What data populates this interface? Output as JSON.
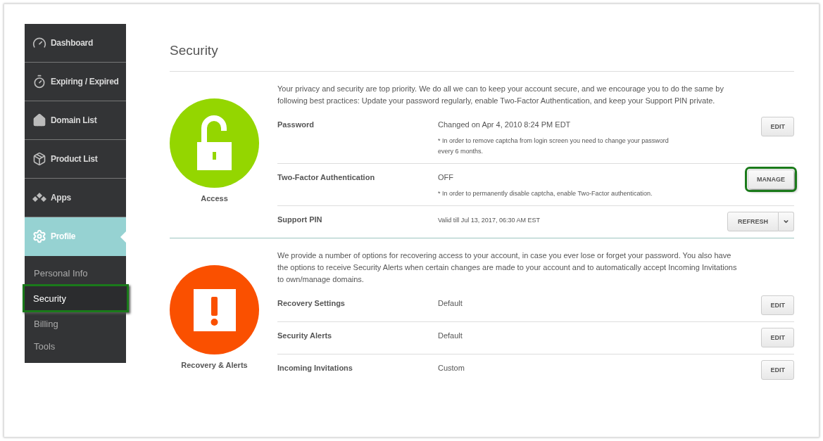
{
  "sidebar": {
    "items": [
      {
        "label": "Dashboard",
        "kind": "gauge",
        "selected": false
      },
      {
        "label": "Expiring / Expired",
        "kind": "timer",
        "selected": false
      },
      {
        "label": "Domain List",
        "kind": "home",
        "selected": false
      },
      {
        "label": "Product List",
        "kind": "package",
        "selected": false
      },
      {
        "label": "Apps",
        "kind": "apps",
        "selected": false
      },
      {
        "label": "Profile",
        "kind": "gear",
        "selected": true
      }
    ],
    "sub_items": [
      {
        "label": "Personal Info",
        "selected": false
      },
      {
        "label": "Security",
        "selected": true
      },
      {
        "label": "Billing",
        "selected": false
      },
      {
        "label": "Tools",
        "selected": false
      }
    ]
  },
  "page_title": "Security",
  "sections": [
    {
      "name": "Access",
      "kind": "lock",
      "description": "Your privacy and security are top priority. We do all we can to keep your account secure, and we encourage you to do the same by following best practices: Update your password regularly, enable Two-Factor Authentication, and keep your Support PIN private.",
      "rows": [
        {
          "label": "Password",
          "value": "Changed on Apr 4, 2010 8:24 PM EDT",
          "note": "* In order to remove captcha from login screen you need to change your password every 6 months.",
          "button": {
            "label": "EDIT",
            "kind": "plain",
            "highlighted": false
          }
        },
        {
          "label": "Two-Factor Authentication",
          "value": "OFF",
          "note": "* In order to permanently disable captcha, enable Two-Factor authentication.",
          "button": {
            "label": "MANAGE",
            "kind": "plain",
            "highlighted": true
          }
        },
        {
          "label": "Support PIN",
          "note": "Valid till Jul 13, 2017, 06:30 AM EST",
          "button": {
            "label": "REFRESH",
            "kind": "split",
            "highlighted": false
          }
        }
      ]
    },
    {
      "name": "Recovery & Alerts",
      "kind": "alert",
      "description": "We provide a number of options for recovering access to your account, in case you ever lose or forget your password. You also have the options to receive Security Alerts when certain changes are made to your account and to automatically accept Incoming Invitations to own/manage domains.",
      "rows": [
        {
          "label": "Recovery Settings",
          "value": "Default",
          "button": {
            "label": "EDIT",
            "kind": "plain",
            "highlighted": false
          }
        },
        {
          "label": "Security Alerts",
          "value": "Default",
          "button": {
            "label": "EDIT",
            "kind": "plain",
            "highlighted": false
          }
        },
        {
          "label": "Incoming Invitations",
          "value": "Custom",
          "button": {
            "label": "EDIT",
            "kind": "plain",
            "highlighted": false
          }
        }
      ]
    }
  ]
}
